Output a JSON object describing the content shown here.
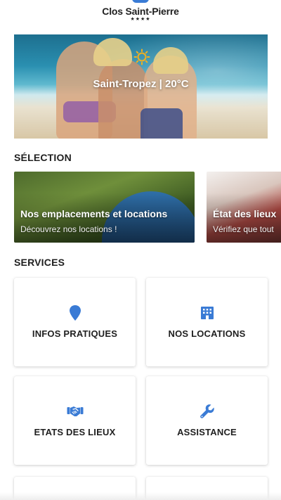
{
  "header": {
    "app_title": "Clos Saint-Pierre",
    "stars": "★★★★"
  },
  "hero": {
    "weather_text": "Saint-Tropez | 20°C",
    "weather_icon": "sun-icon"
  },
  "selection": {
    "title": "SÉLECTION",
    "cards": [
      {
        "title": "Nos emplacements et locations",
        "subtitle": "Découvrez nos locations !"
      },
      {
        "title": "État des lieux",
        "subtitle": "Vérifiez que tout"
      }
    ]
  },
  "services": {
    "title": "SERVICES",
    "tiles": [
      {
        "label": "INFOS PRATIQUES",
        "icon": "map-pin-icon"
      },
      {
        "label": "NOS LOCATIONS",
        "icon": "building-icon"
      },
      {
        "label": "ETATS DES LIEUX",
        "icon": "handshake-icon"
      },
      {
        "label": "ASSISTANCE",
        "icon": "wrench-icon"
      }
    ]
  },
  "colors": {
    "accent": "#3a7bd5",
    "sun": "#f2b01e"
  }
}
